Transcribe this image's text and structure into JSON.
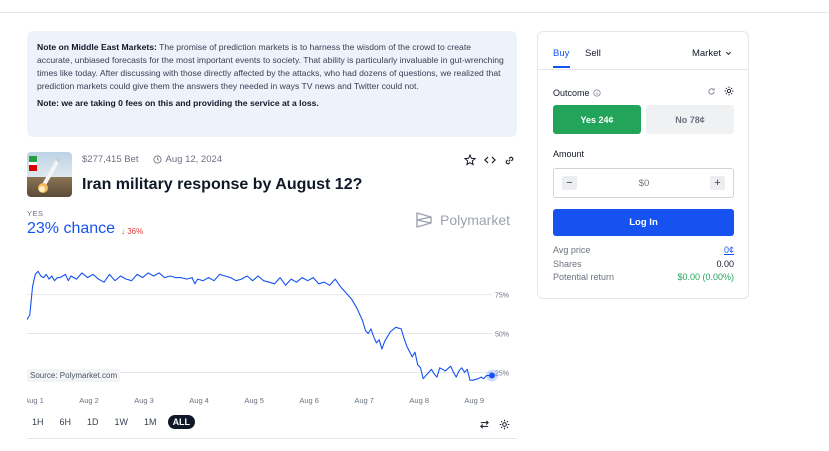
{
  "note": {
    "heading": "Note on Middle East Markets:",
    "body": "The promise of prediction markets is to harness the wisdom of the crowd to create accurate, unbiased forecasts for the most important events to society. That ability is particularly invaluable in gut-wrenching times like today. After discussing with those directly affected by the attacks, who had dozens of questions, we realized that prediction markets could give them the answers they needed in ways TV news and Twitter could not.",
    "fee_note": "Note: we are taking 0 fees on this and providing the service at a loss."
  },
  "market": {
    "volume": "$277,415 Bet",
    "date": "Aug 12, 2024",
    "title": "Iran military response by August 12?",
    "outcome_label": "YES",
    "chance": "23% chance",
    "delta": "36%",
    "brand": "Polymarket",
    "source": "Source: Polymarket.com"
  },
  "chart_data": {
    "type": "line",
    "x_ticks": [
      "Aug 1",
      "Aug 2",
      "Aug 3",
      "Aug 4",
      "Aug 5",
      "Aug 6",
      "Aug 7",
      "Aug 8",
      "Aug 9"
    ],
    "y_ticks": [
      "75%",
      "50%",
      "25%"
    ],
    "y_tick_values": [
      75,
      50,
      25
    ],
    "ylim": [
      15,
      105
    ],
    "xlim": [
      1,
      9.45
    ],
    "colors": {
      "line": "#1652f0",
      "grid": "#e5e7eb",
      "tick": "#6b7280"
    },
    "series": [
      {
        "points": [
          [
            1.0,
            59
          ],
          [
            1.05,
            62
          ],
          [
            1.1,
            80
          ],
          [
            1.15,
            88
          ],
          [
            1.2,
            90
          ],
          [
            1.25,
            87
          ],
          [
            1.3,
            86
          ],
          [
            1.35,
            88
          ],
          [
            1.4,
            85
          ],
          [
            1.45,
            87
          ],
          [
            1.5,
            84
          ],
          [
            1.55,
            86
          ],
          [
            1.6,
            86
          ],
          [
            1.7,
            88
          ],
          [
            1.75,
            84
          ],
          [
            1.8,
            87
          ],
          [
            1.9,
            85
          ],
          [
            2.0,
            89
          ],
          [
            2.1,
            86
          ],
          [
            2.2,
            88
          ],
          [
            2.3,
            85
          ],
          [
            2.4,
            83
          ],
          [
            2.5,
            88
          ],
          [
            2.6,
            84
          ],
          [
            2.7,
            87
          ],
          [
            2.8,
            85
          ],
          [
            2.9,
            84
          ],
          [
            3.0,
            88
          ],
          [
            3.1,
            86
          ],
          [
            3.2,
            89
          ],
          [
            3.3,
            87
          ],
          [
            3.4,
            89
          ],
          [
            3.5,
            86
          ],
          [
            3.6,
            87
          ],
          [
            3.7,
            86
          ],
          [
            3.8,
            86
          ],
          [
            3.9,
            85
          ],
          [
            4.0,
            86
          ],
          [
            4.05,
            82
          ],
          [
            4.1,
            85
          ],
          [
            4.2,
            84
          ],
          [
            4.3,
            86
          ],
          [
            4.4,
            84
          ],
          [
            4.5,
            88
          ],
          [
            4.6,
            87
          ],
          [
            4.7,
            86
          ],
          [
            4.8,
            84
          ],
          [
            4.9,
            85
          ],
          [
            5.0,
            87
          ],
          [
            5.1,
            84
          ],
          [
            5.2,
            87
          ],
          [
            5.3,
            84
          ],
          [
            5.4,
            83
          ],
          [
            5.5,
            82
          ],
          [
            5.6,
            86
          ],
          [
            5.7,
            81
          ],
          [
            5.8,
            85
          ],
          [
            5.9,
            83
          ],
          [
            6.0,
            86
          ],
          [
            6.1,
            84
          ],
          [
            6.2,
            86
          ],
          [
            6.3,
            82
          ],
          [
            6.4,
            83
          ],
          [
            6.5,
            81
          ],
          [
            6.6,
            85
          ],
          [
            6.7,
            80
          ],
          [
            6.8,
            76
          ],
          [
            6.9,
            72
          ],
          [
            7.0,
            66
          ],
          [
            7.1,
            58
          ],
          [
            7.15,
            52
          ],
          [
            7.2,
            50
          ],
          [
            7.25,
            53
          ],
          [
            7.3,
            48
          ],
          [
            7.35,
            44
          ],
          [
            7.4,
            46
          ],
          [
            7.45,
            40
          ],
          [
            7.5,
            45
          ],
          [
            7.6,
            51
          ],
          [
            7.7,
            54
          ],
          [
            7.8,
            53
          ],
          [
            7.85,
            47
          ],
          [
            7.9,
            42
          ],
          [
            8.0,
            35
          ],
          [
            8.05,
            38
          ],
          [
            8.1,
            30
          ],
          [
            8.15,
            28
          ],
          [
            8.2,
            21
          ],
          [
            8.3,
            25
          ],
          [
            8.35,
            27
          ],
          [
            8.4,
            24
          ],
          [
            8.45,
            22
          ],
          [
            8.5,
            28
          ],
          [
            8.6,
            26
          ],
          [
            8.7,
            29
          ],
          [
            8.75,
            25
          ],
          [
            8.8,
            22
          ],
          [
            8.85,
            26
          ],
          [
            8.9,
            28
          ],
          [
            8.95,
            25
          ],
          [
            9.0,
            27
          ],
          [
            9.05,
            20
          ],
          [
            9.1,
            20
          ],
          [
            9.2,
            21
          ],
          [
            9.25,
            22
          ],
          [
            9.3,
            21
          ],
          [
            9.35,
            23
          ],
          [
            9.4,
            23
          ],
          [
            9.45,
            23
          ]
        ]
      }
    ]
  },
  "ranges": [
    "1H",
    "6H",
    "1D",
    "1W",
    "1M",
    "ALL"
  ],
  "active_range": "ALL",
  "panel": {
    "tab_buy": "Buy",
    "tab_sell": "Sell",
    "order_type": "Market",
    "outcome_label": "Outcome",
    "yes_btn": "Yes 24¢",
    "no_btn": "No 78¢",
    "amount_label": "Amount",
    "amount_placeholder": "$0",
    "login": "Log In",
    "stats": [
      {
        "label": "Avg price",
        "value": "0¢"
      },
      {
        "label": "Shares",
        "value": "0.00"
      },
      {
        "label": "Potential return",
        "value": "$0.00 (0.00%)"
      }
    ]
  }
}
